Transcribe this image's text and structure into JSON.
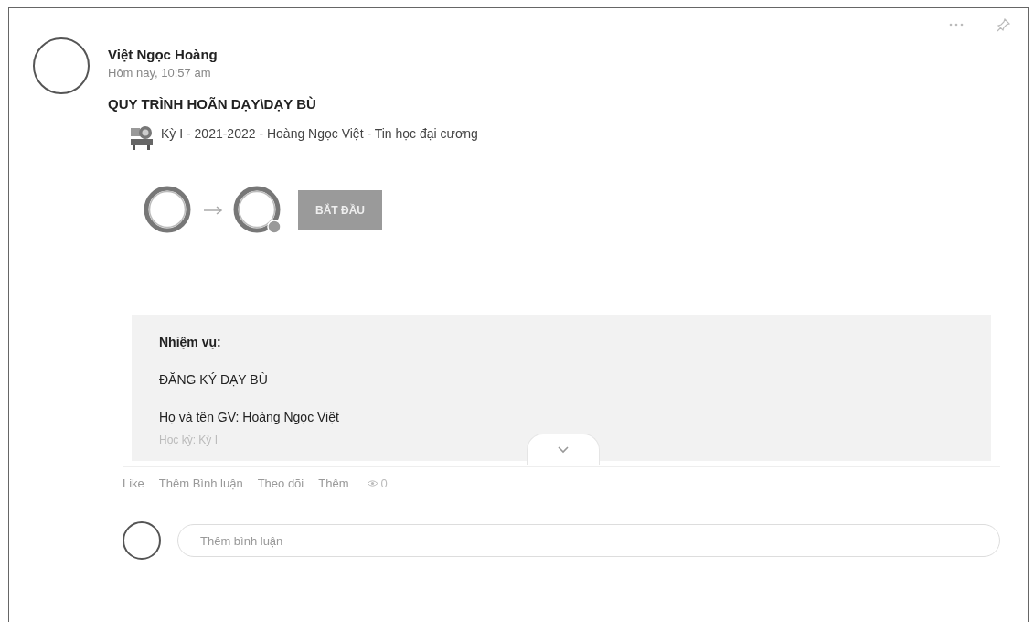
{
  "post": {
    "author": "Việt Ngọc Hoàng",
    "time": "Hôm nay, 10:57 am",
    "title": "QUY TRÌNH HOÃN DẠY\\DẠY BÙ",
    "course": "Kỳ I - 2021-2022 - Hoàng Ngọc Việt - Tin học đại cương"
  },
  "workflow": {
    "steps": [
      {
        "badge": false
      },
      {
        "badge": true
      }
    ],
    "button": "BẮT ĐẦU"
  },
  "task_lines": [
    {
      "kind": "heading",
      "text": "Nhiệm vụ:"
    },
    {
      "kind": "plain",
      "text": "ĐĂNG KÝ DẠY BÙ"
    },
    {
      "kind": "plain",
      "text": "Họ và tên GV: Hoàng Ngọc Việt"
    },
    {
      "kind": "partial",
      "text": "Học kỳ: Kỳ I"
    }
  ],
  "actions": [
    "Like",
    "Thêm Bình luận",
    "Theo dõi",
    "Thêm"
  ],
  "views": "0",
  "comment": {
    "placeholder": "Thêm bình luận"
  }
}
